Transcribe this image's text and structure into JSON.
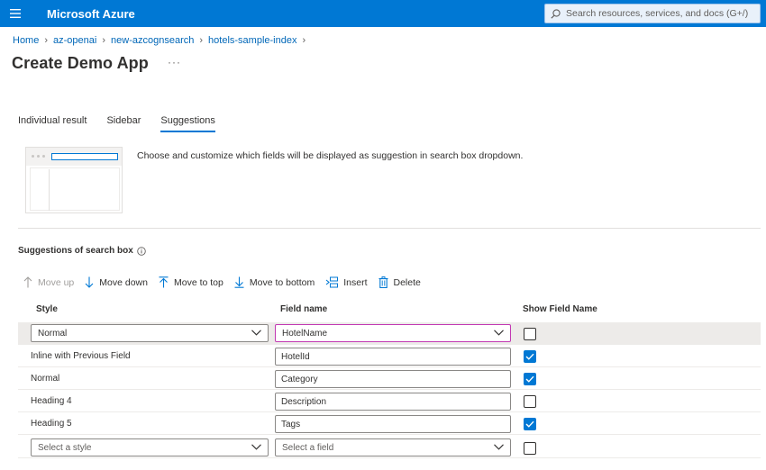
{
  "app": {
    "title": "Microsoft Azure"
  },
  "search": {
    "placeholder": "Search resources, services, and docs (G+/)"
  },
  "breadcrumb": [
    "Home",
    "az-openai",
    "new-azcognsearch",
    "hotels-sample-index"
  ],
  "page": {
    "title": "Create Demo App",
    "more": "···"
  },
  "tabs": [
    {
      "label": "Individual result",
      "active": false
    },
    {
      "label": "Sidebar",
      "active": false
    },
    {
      "label": "Suggestions",
      "active": true
    }
  ],
  "description": "Choose and customize which fields will be displayed as suggestion in search box dropdown.",
  "section": {
    "title": "Suggestions of search box"
  },
  "toolbar": {
    "move_up": "Move up",
    "move_down": "Move down",
    "move_to_top": "Move to top",
    "move_to_bottom": "Move to bottom",
    "insert": "Insert",
    "delete": "Delete"
  },
  "table": {
    "headers": {
      "style": "Style",
      "field": "Field name",
      "show": "Show Field Name"
    },
    "rows": [
      {
        "style": "Normal",
        "field": "HotelName",
        "show": false,
        "style_dropdown": true,
        "field_dropdown": true,
        "selected": true
      },
      {
        "style": "Inline with Previous Field",
        "field": "HotelId",
        "show": true
      },
      {
        "style": "Normal",
        "field": "Category",
        "show": true
      },
      {
        "style": "Heading 4",
        "field": "Description",
        "show": false
      },
      {
        "style": "Heading 5",
        "field": "Tags",
        "show": true
      },
      {
        "style": "Select a style",
        "field": "Select a field",
        "show": false,
        "style_dropdown": true,
        "field_dropdown": true
      }
    ]
  },
  "colors": {
    "accent": "#0078d4",
    "topbar": "#0078d4",
    "link": "#0067b8",
    "focus_border": "#c239b3"
  }
}
